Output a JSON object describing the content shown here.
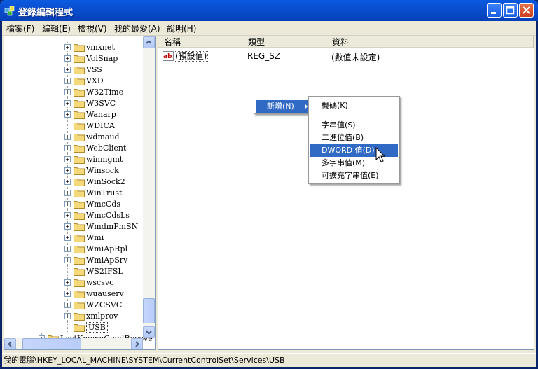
{
  "window": {
    "title": "登錄編輯程式"
  },
  "menubar": [
    "檔案(F)",
    "編輯(E)",
    "檢視(V)",
    "我的最愛(A)",
    "說明(H)"
  ],
  "tree": {
    "items": [
      {
        "label": "vmxnet",
        "expander": "+"
      },
      {
        "label": "VolSnap",
        "expander": "+"
      },
      {
        "label": "VSS",
        "expander": "+"
      },
      {
        "label": "VXD",
        "expander": "+"
      },
      {
        "label": "W32Time",
        "expander": "+"
      },
      {
        "label": "W3SVC",
        "expander": "+"
      },
      {
        "label": "Wanarp",
        "expander": "+"
      },
      {
        "label": "WDICA",
        "expander": ""
      },
      {
        "label": "wdmaud",
        "expander": "+"
      },
      {
        "label": "WebClient",
        "expander": "+"
      },
      {
        "label": "winmgmt",
        "expander": "+"
      },
      {
        "label": "Winsock",
        "expander": "+"
      },
      {
        "label": "WinSock2",
        "expander": "+"
      },
      {
        "label": "WinTrust",
        "expander": "+"
      },
      {
        "label": "WmcCds",
        "expander": "+"
      },
      {
        "label": "WmcCdsLs",
        "expander": "+"
      },
      {
        "label": "WmdmPmSN",
        "expander": "+"
      },
      {
        "label": "Wmi",
        "expander": "+"
      },
      {
        "label": "WmiApRpl",
        "expander": "+"
      },
      {
        "label": "WmiApSrv",
        "expander": "+"
      },
      {
        "label": "WS2IFSL",
        "expander": ""
      },
      {
        "label": "wscsvc",
        "expander": "+"
      },
      {
        "label": "wuauserv",
        "expander": "+"
      },
      {
        "label": "WZCSVC",
        "expander": "+"
      },
      {
        "label": "xmlprov",
        "expander": "+"
      },
      {
        "label": "USB",
        "expander": "",
        "selected": true
      }
    ],
    "bottom_item": {
      "label": "LastKnownGoodRecove",
      "expander": "+"
    }
  },
  "list": {
    "columns": [
      "名稱",
      "類型",
      "資料"
    ],
    "rows": [
      {
        "name": "(預設值)",
        "type": "REG_SZ",
        "data": "(數值未設定)"
      }
    ]
  },
  "context_menu": {
    "new_label": "新增(N)"
  },
  "submenu": {
    "items": [
      "機碼(K)",
      "字串值(S)",
      "二進位值(B)",
      "DWORD 值(D)",
      "多字串值(M)",
      "可擴充字串值(E)"
    ],
    "highlighted": "DWORD 值(D)"
  },
  "status": {
    "path": "我的電腦\\HKEY_LOCAL_MACHINE\\SYSTEM\\CurrentControlSet\\Services\\USB"
  },
  "colors": {
    "highlight": "#316ac5",
    "titlebar": "#0a4fd0"
  }
}
